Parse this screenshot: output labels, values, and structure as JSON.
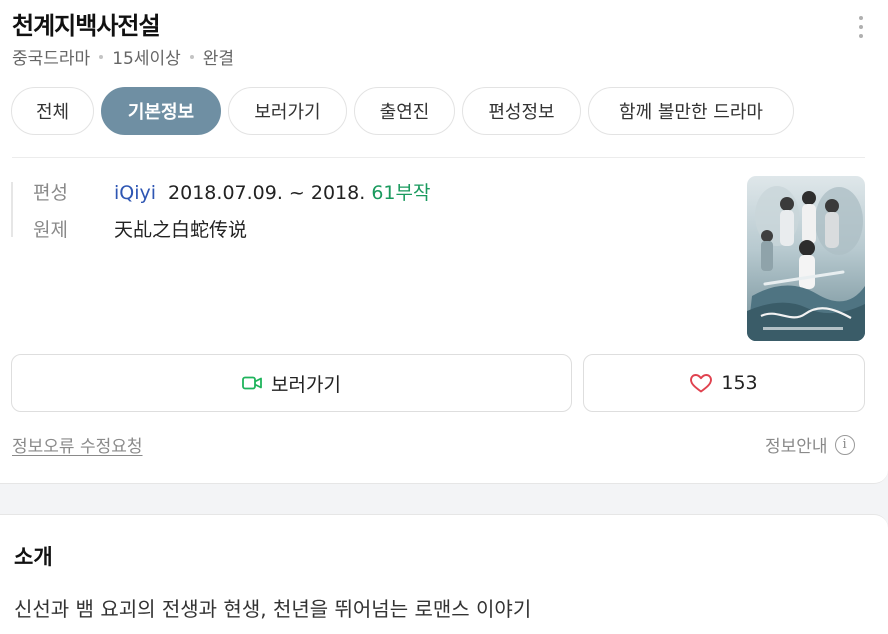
{
  "header": {
    "title": "천계지백사전설",
    "meta": [
      "중국드라마",
      "15세이상",
      "완결"
    ]
  },
  "tabs": [
    {
      "label": "전체",
      "active": false
    },
    {
      "label": "기본정보",
      "active": true
    },
    {
      "label": "보러가기",
      "active": false
    },
    {
      "label": "출연진",
      "active": false
    },
    {
      "label": "편성정보",
      "active": false
    },
    {
      "label": "함께 볼만한 드라마",
      "active": false
    }
  ],
  "info": {
    "broadcast_label": "편성",
    "network": "iQiyi",
    "period": "2018.07.09. ~ 2018.",
    "episodes": "61부작",
    "original_label": "원제",
    "original_title": "天乩之白蛇传说"
  },
  "actions": {
    "watch_label": "보러가기",
    "like_count": "153"
  },
  "footer": {
    "edit_request": "정보오류 수정요청",
    "info_guide": "정보안내"
  },
  "intro": {
    "title": "소개",
    "text": "신선과 뱀 요괴의 전생과 현생, 천년을 뛰어넘는 로맨스 이야기"
  },
  "colors": {
    "active_tab": "#6f8fa3",
    "network_link": "#2e56b3",
    "episode_count": "#1a9a5e",
    "like_heart": "#e0424f",
    "watch_icon": "#1fb45c"
  },
  "icons": [
    "more-vertical-icon",
    "video-camera-icon",
    "heart-icon",
    "info-circle-icon"
  ]
}
